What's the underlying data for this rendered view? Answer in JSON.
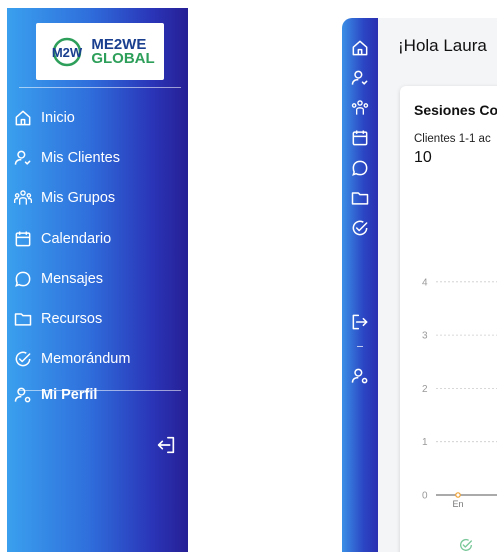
{
  "logo": {
    "mark": "M2W",
    "line1": "ME2WE",
    "line2": "GLOBAL"
  },
  "sidebar": {
    "items": [
      {
        "label": "Inicio",
        "icon": "home-icon"
      },
      {
        "label": "Mis Clientes",
        "icon": "user-heart-icon"
      },
      {
        "label": "Mis Grupos",
        "icon": "group-icon"
      },
      {
        "label": "Calendario",
        "icon": "calendar-icon"
      },
      {
        "label": "Mensajes",
        "icon": "chat-bubble-icon"
      },
      {
        "label": "Recursos",
        "icon": "folder-icon"
      },
      {
        "label": "Memorándum",
        "icon": "check-circle-icon"
      }
    ],
    "profile": {
      "label": "Mi Perfil",
      "icon": "user-settings-icon"
    },
    "logout_icon": "logout-icon"
  },
  "rail": {
    "icons": [
      "home-icon",
      "user-heart-icon",
      "group-icon",
      "calendar-icon",
      "chat-bubble-icon",
      "folder-icon",
      "check-circle-icon",
      "login-icon",
      "user-settings-icon"
    ]
  },
  "main": {
    "greeting": "¡Hola Laura",
    "card": {
      "title": "Sesiones Co",
      "subtitle": "Clientes 1-1 ac",
      "count": "10"
    }
  },
  "chart_data": {
    "type": "line",
    "x": [
      "En"
    ],
    "series": [
      {
        "values": [
          0
        ]
      }
    ],
    "ylim": [
      0,
      4
    ],
    "yticks": [
      "0",
      "1",
      "2",
      "3",
      "4"
    ],
    "grid": true
  },
  "colors": {
    "sidebar_light": "#3aa0ee",
    "sidebar_dark": "#261f95",
    "line": "#f0a030"
  }
}
